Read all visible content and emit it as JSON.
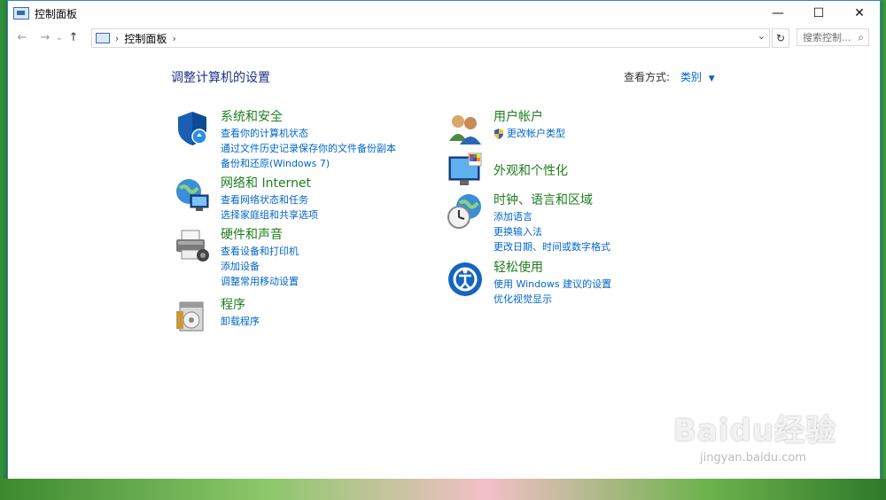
{
  "window": {
    "title": "控制面板"
  },
  "window_buttons": {
    "minimize": "—",
    "maximize": "☐",
    "close": "✕"
  },
  "nav": {
    "back": "←",
    "forward": "→",
    "recent": "⌄",
    "up": "↑"
  },
  "address": {
    "separator": "›",
    "crumb": "控制面板",
    "trail": "›",
    "dropdown": "⌄",
    "refresh": "↻"
  },
  "search": {
    "placeholder": "搜索控制...",
    "icon": "⌕"
  },
  "content": {
    "title": "调整计算机的设置",
    "view_by_label": "查看方式:",
    "view_by_value": "类别",
    "view_by_caret": "▼"
  },
  "categories": [
    {
      "title": "系统和安全",
      "icon": "shield-icon",
      "links": [
        "查看你的计算机状态",
        "通过文件历史记录保存你的文件备份副本",
        "备份和还原(Windows 7)"
      ]
    },
    {
      "title": "网络和 Internet",
      "icon": "network-globe-icon",
      "links": [
        "查看网络状态和任务",
        "选择家庭组和共享选项"
      ]
    },
    {
      "title": "硬件和声音",
      "icon": "printer-icon",
      "links": [
        "查看设备和打印机",
        "添加设备",
        "调整常用移动设置"
      ]
    },
    {
      "title": "程序",
      "icon": "programs-icon",
      "links": [
        "卸载程序"
      ]
    },
    {
      "title": "用户帐户",
      "icon": "users-icon",
      "links": [
        "更改帐户类型"
      ]
    },
    {
      "title": "外观和个性化",
      "icon": "monitor-icon",
      "links": []
    },
    {
      "title": "时钟、语言和区域",
      "icon": "clock-globe-icon",
      "links": [
        "添加语言",
        "更换输入法",
        "更改日期、时间或数字格式"
      ]
    },
    {
      "title": "轻松使用",
      "icon": "ease-of-access-icon",
      "links": [
        "使用 Windows 建议的设置",
        "优化视觉显示"
      ]
    }
  ],
  "watermark": {
    "main": "Baidu经验",
    "sub": "jingyan.baidu.com"
  },
  "colors": {
    "title_blue": "#1e3287",
    "category_green": "#1e7d1e",
    "link_blue": "#0066cc"
  }
}
